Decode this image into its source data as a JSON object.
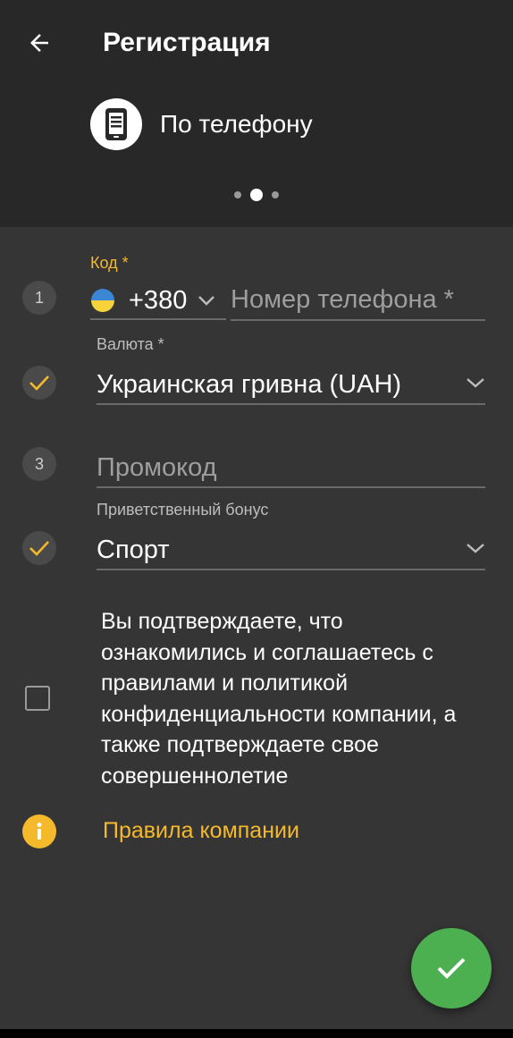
{
  "header": {
    "title": "Регистрация",
    "back_icon": "arrow-left-icon",
    "method_icon": "smartphone-icon",
    "method_label": "По телефону",
    "pager": {
      "count": 3,
      "active": 1
    }
  },
  "form": {
    "step_phone": "1",
    "code": {
      "label": "Код *",
      "flag": "ukraine-flag",
      "value": "+380"
    },
    "phone": {
      "placeholder": "Номер телефона *",
      "value": ""
    },
    "currency": {
      "label": "Валюта *",
      "value": "Украинская гривна (UAH)",
      "status_icon": "checkmark-icon"
    },
    "step_promo": "3",
    "promo": {
      "placeholder": "Промокод",
      "value": ""
    },
    "bonus": {
      "label": "Приветственный бонус",
      "value": "Спорт",
      "status_icon": "checkmark-icon"
    }
  },
  "consent": {
    "checked": false,
    "text": "Вы подтверждаете, что ознакомились и соглашаетесь с правилами и политикой конфиденциальности компании, а также подтверждаете свое совершеннолетие"
  },
  "rules": {
    "icon": "info-icon",
    "label": "Правила компании"
  },
  "submit": {
    "icon": "check-icon"
  },
  "colors": {
    "accent": "#f5b92c",
    "submit": "#4caf50",
    "header_bg": "#282828",
    "body_bg": "#353535"
  }
}
